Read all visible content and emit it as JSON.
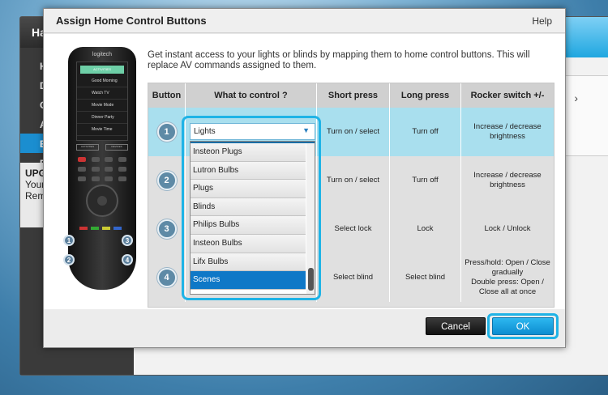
{
  "background_app": {
    "title": "Ha",
    "sidebar_items": [
      "H",
      "D",
      "G",
      "A",
      "E",
      "F",
      "S"
    ],
    "active_index": 4,
    "upgrade": {
      "heading": "UPG",
      "line1": "Your",
      "line2": "Remo"
    },
    "chevron": "›"
  },
  "dialog": {
    "title": "Assign Home Control Buttons",
    "help": "Help",
    "description": "Get instant access to your lights or blinds by mapping them to home control buttons. This will replace AV commands assigned to them."
  },
  "remote": {
    "brand": "logitech",
    "screen_header": "ACTIVITIES",
    "screen_items": [
      "Good Morning",
      "Watch TV",
      "Movie Mode",
      "Dinner Party",
      "Movie Time"
    ],
    "tabs": [
      "ACTIVITIES",
      "DEVICES"
    ],
    "badges": [
      "1",
      "2",
      "3",
      "4"
    ]
  },
  "table": {
    "headers": [
      "Button",
      "What to control ?",
      "Short press",
      "Long press",
      "Rocker switch +/-"
    ],
    "rows": [
      {
        "button": "1",
        "short": "Turn on / select",
        "long": "Turn off",
        "rocker": "Increase / decrease brightness"
      },
      {
        "button": "2",
        "short": "Turn on / select",
        "long": "Turn off",
        "rocker": "Increase / decrease brightness"
      },
      {
        "button": "3",
        "short": "Select lock",
        "long": "Lock",
        "rocker": "Lock / Unlock"
      },
      {
        "button": "4",
        "short": "Select blind",
        "long": "Select blind",
        "rocker": "Press/hold: Open / Close gradually\nDouble press: Open / Close all at once"
      }
    ]
  },
  "dropdown": {
    "selected_value": "Lights",
    "options": [
      "Insteon Plugs",
      "Lutron Bulbs",
      "Plugs",
      "Blinds",
      "Philips Bulbs",
      "Insteon Bulbs",
      "Lifx Bulbs",
      "Scenes"
    ],
    "highlighted_option": "Scenes",
    "arrow": "▼"
  },
  "footer": {
    "cancel_label": "Cancel",
    "ok_label": "OK"
  },
  "colors": {
    "accent": "#1fb3e6",
    "selected_row": "#a9dfee",
    "selected_option": "#0f78c7"
  }
}
